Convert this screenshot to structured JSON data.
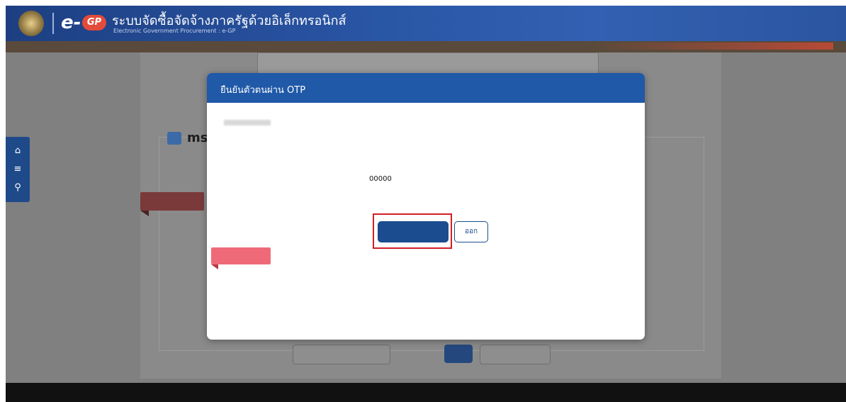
{
  "header": {
    "logo_text": "e-GP",
    "site_title": "ระบบจัดซื้อจัดจ้างภาครัฐด้วยอิเล็กทรอนิกส์",
    "site_subtitle": "Electronic Government Procurement : e-GP",
    "right_line1": "",
    "right_line2": "",
    "strip_text": ""
  },
  "sidebar": {
    "icons": [
      "home-icon",
      "menu-icon",
      "search-icon"
    ]
  },
  "background": {
    "notice_lines": [
      "",
      "",
      ""
    ],
    "section_title": "ms",
    "red_tag": "",
    "buttons": [
      {
        "label": "",
        "kind": "secondary"
      },
      {
        "label": "",
        "kind": "primary"
      },
      {
        "label": "",
        "kind": "secondary"
      }
    ],
    "footer_text": ""
  },
  "modal": {
    "title": "ยืนยันตัวตนผ่าน OTP",
    "intro_before": "",
    "intro_after": "",
    "ref_label": "",
    "otp_value": "00000",
    "expiry_text": "",
    "confirm_label": "",
    "exit_label": "ออก",
    "note_tag": "",
    "note_head": "",
    "note_items": [
      "",
      ""
    ]
  },
  "colors": {
    "header_blue": "#2a56a6",
    "modal_header": "#1f59a7",
    "primary_button": "#1b4c8f",
    "highlight_outline": "#d11f26",
    "note_tag": "#ee6a78"
  }
}
